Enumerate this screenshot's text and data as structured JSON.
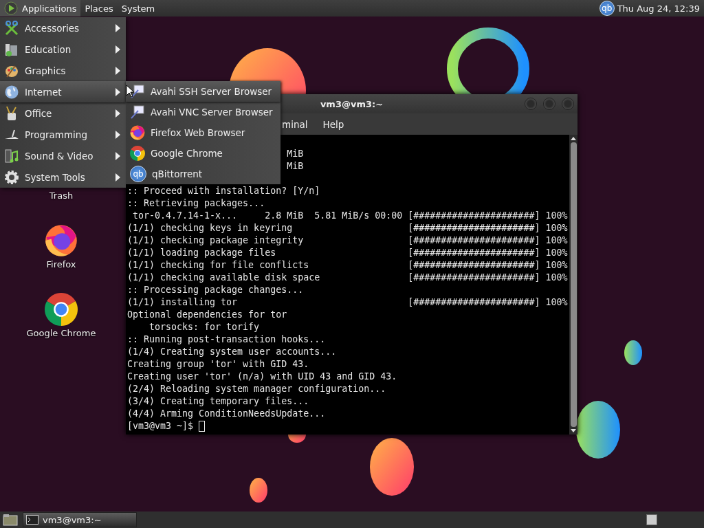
{
  "top_panel": {
    "menus": [
      {
        "label": "Applications",
        "selected": true
      },
      {
        "label": "Places",
        "selected": false
      },
      {
        "label": "System",
        "selected": false
      }
    ],
    "tray_icon_text": "qb",
    "clock": "Thu Aug 24, 12:39"
  },
  "applications_menu": {
    "items": [
      {
        "label": "Accessories",
        "kind": "accessories",
        "selected": false
      },
      {
        "label": "Education",
        "kind": "education",
        "selected": false
      },
      {
        "label": "Graphics",
        "kind": "graphics",
        "selected": false
      },
      {
        "label": "Internet",
        "kind": "internet",
        "selected": true
      },
      {
        "label": "Office",
        "kind": "office",
        "selected": false
      },
      {
        "label": "Programming",
        "kind": "programming",
        "selected": false
      },
      {
        "label": "Sound & Video",
        "kind": "sound_video",
        "selected": false
      },
      {
        "label": "System Tools",
        "kind": "system_tools",
        "selected": false
      }
    ]
  },
  "submenu": {
    "items": [
      {
        "label": "Avahi SSH Server Browser",
        "kind": "avahi",
        "selected": true
      },
      {
        "label": "Avahi VNC Server Browser",
        "kind": "avahi",
        "selected": false
      },
      {
        "label": "Firefox Web Browser",
        "kind": "firefox",
        "selected": false
      },
      {
        "label": "Google Chrome",
        "kind": "chrome",
        "selected": false
      },
      {
        "label": "qBittorrent",
        "kind": "qb",
        "icon_text": "qb",
        "selected": false
      }
    ]
  },
  "desktop_icons": [
    {
      "label": "Trash",
      "kind": "label_only"
    },
    {
      "label": "Firefox",
      "kind": "firefox"
    },
    {
      "label": "Google Chrome",
      "kind": "chrome"
    }
  ],
  "terminal": {
    "title": "vm3@vm3:~",
    "menus": [
      "minal",
      "Help"
    ],
    "lines": [
      {
        "kind": "tail",
        "text": "MiB"
      },
      {
        "kind": "tail",
        "text": "MiB"
      },
      {
        "kind": "text",
        "text": ":: Proceed with installation? [Y/n]"
      },
      {
        "kind": "text",
        "text": ":: Retrieving packages..."
      },
      {
        "kind": "progress",
        "text": " tor-0.4.7.14-1-x...     2.8 MiB  5.81 MiB/s 00:00",
        "bar": "[######################]",
        "percent": "100%"
      },
      {
        "kind": "progress",
        "text": "(1/1) checking keys in keyring",
        "bar": "[######################]",
        "percent": "100%"
      },
      {
        "kind": "progress",
        "text": "(1/1) checking package integrity",
        "bar": "[######################]",
        "percent": "100%"
      },
      {
        "kind": "progress",
        "text": "(1/1) loading package files",
        "bar": "[######################]",
        "percent": "100%"
      },
      {
        "kind": "progress",
        "text": "(1/1) checking for file conflicts",
        "bar": "[######################]",
        "percent": "100%"
      },
      {
        "kind": "progress",
        "text": "(1/1) checking available disk space",
        "bar": "[######################]",
        "percent": "100%"
      },
      {
        "kind": "text",
        "text": ":: Processing package changes..."
      },
      {
        "kind": "progress",
        "text": "(1/1) installing tor",
        "bar": "[######################]",
        "percent": "100%"
      },
      {
        "kind": "text",
        "text": "Optional dependencies for tor"
      },
      {
        "kind": "text",
        "text": "    torsocks: for torify"
      },
      {
        "kind": "text",
        "text": ":: Running post-transaction hooks..."
      },
      {
        "kind": "text",
        "text": "(1/4) Creating system user accounts..."
      },
      {
        "kind": "text",
        "text": "Creating group 'tor' with GID 43."
      },
      {
        "kind": "text",
        "text": "Creating user 'tor' (n/a) with UID 43 and GID 43."
      },
      {
        "kind": "text",
        "text": "(2/4) Reloading system manager configuration..."
      },
      {
        "kind": "text",
        "text": "(3/4) Creating temporary files..."
      },
      {
        "kind": "text",
        "text": "(4/4) Arming ConditionNeedsUpdate..."
      },
      {
        "kind": "prompt",
        "text": "[vm3@vm3 ~]$"
      }
    ]
  },
  "taskbar": {
    "tasks": [
      {
        "label": "vm3@vm3:~",
        "selected": true
      }
    ]
  }
}
